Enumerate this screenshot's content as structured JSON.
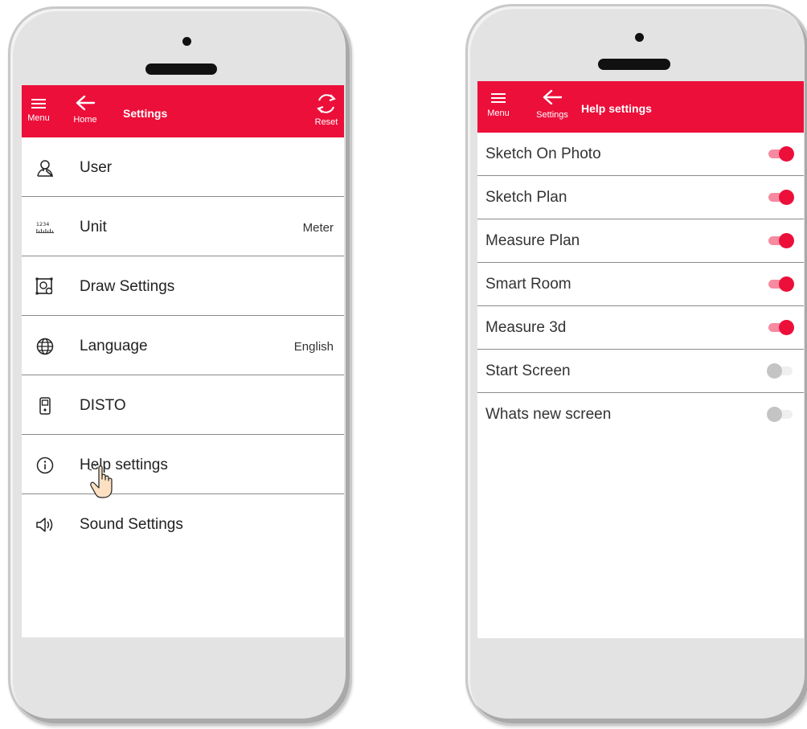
{
  "left_screen": {
    "appbar": {
      "menu_label": "Menu",
      "home_label": "Home",
      "title": "Settings",
      "reset_label": "Reset"
    },
    "items": [
      {
        "label": "User",
        "value": "",
        "icon": "user-icon"
      },
      {
        "label": "Unit",
        "value": "Meter",
        "icon": "ruler-icon"
      },
      {
        "label": "Draw Settings",
        "value": "",
        "icon": "draw-settings-icon"
      },
      {
        "label": "Language",
        "value": "English",
        "icon": "globe-icon"
      },
      {
        "label": "DISTO",
        "value": "",
        "icon": "disto-device-icon"
      },
      {
        "label": "Help settings",
        "value": "",
        "icon": "info-icon"
      },
      {
        "label": "Sound Settings",
        "value": "",
        "icon": "speaker-icon"
      }
    ],
    "ruler_icon_digits": "1234"
  },
  "right_screen": {
    "appbar": {
      "menu_label": "Menu",
      "back_label": "Settings",
      "title": "Help settings"
    },
    "items": [
      {
        "label": "Sketch On Photo",
        "enabled": true
      },
      {
        "label": "Sketch Plan",
        "enabled": true
      },
      {
        "label": "Measure Plan",
        "enabled": true
      },
      {
        "label": "Smart Room",
        "enabled": true
      },
      {
        "label": "Measure 3d",
        "enabled": true
      },
      {
        "label": "Start Screen",
        "enabled": false
      },
      {
        "label": "Whats new screen",
        "enabled": false
      }
    ]
  },
  "colors": {
    "accent": "#ec0f3a",
    "toggle_on_track": "#f58aa0",
    "toggle_off_knob": "#c4c4c4",
    "phone_body": "#e3e3e3"
  }
}
